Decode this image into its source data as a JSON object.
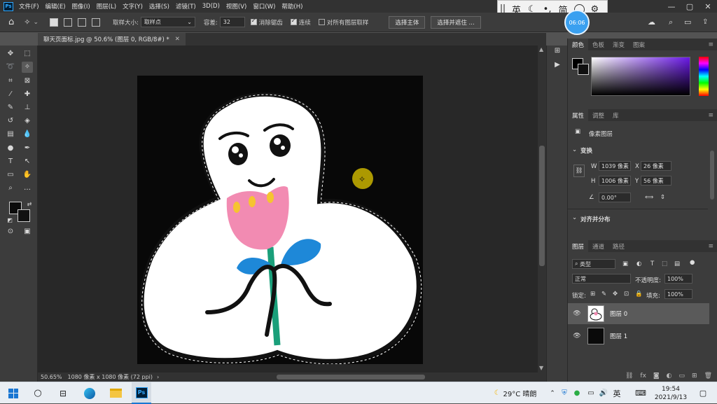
{
  "menubar": {
    "items": [
      "文件(F)",
      "编辑(E)",
      "图像(I)",
      "图层(L)",
      "文字(Y)",
      "选择(S)",
      "滤镜(T)",
      "3D(D)",
      "视图(V)",
      "窗口(W)",
      "帮助(H)"
    ]
  },
  "ime": {
    "items": [
      "英",
      "简"
    ]
  },
  "options": {
    "sample_size_label": "取样大小:",
    "sample_size_value": "取样点",
    "tolerance_label": "容差:",
    "tolerance_value": "32",
    "antialias_label": "消除锯齿",
    "contiguous_label": "连续",
    "sample_all_label": "对所有图层取样",
    "select_subject": "选择主体",
    "select_mask": "选择并遮住 ...",
    "clock": "06:06"
  },
  "document": {
    "tab_title": "聊天页面标.jpg @ 50.6% (图层 0, RGB/8#) *",
    "zoom": "50.65%",
    "dimensions": "1080 像素 x 1080 像素 (72 ppi)"
  },
  "color_panel": {
    "tabs": [
      "颜色",
      "色板",
      "渐变",
      "图案"
    ],
    "accent": "#6a18e6"
  },
  "properties": {
    "tabs": [
      "属性",
      "调整",
      "库"
    ],
    "kind": "像素图层",
    "transform_header": "变换",
    "w_label": "W",
    "w_value": "1039 像素",
    "x_label": "X",
    "x_value": "26 像素",
    "h_label": "H",
    "h_value": "1006 像素",
    "y_label": "Y",
    "y_value": "56 像素",
    "angle": "0.00°",
    "align_header": "对齐并分布"
  },
  "layers": {
    "tabs": [
      "图层",
      "通道",
      "路径"
    ],
    "filter_kind": "类型",
    "blend_mode": "正常",
    "opacity_label": "不透明度:",
    "opacity_value": "100%",
    "lock_label": "锁定:",
    "fill_label": "填充:",
    "fill_value": "100%",
    "items": [
      {
        "name": "图层 0",
        "selected": true
      },
      {
        "name": "图层 1",
        "selected": false
      }
    ]
  },
  "taskbar": {
    "weather": "29°C 晴朗",
    "lang": "英",
    "time": "19:54",
    "date": "2021/9/13"
  }
}
